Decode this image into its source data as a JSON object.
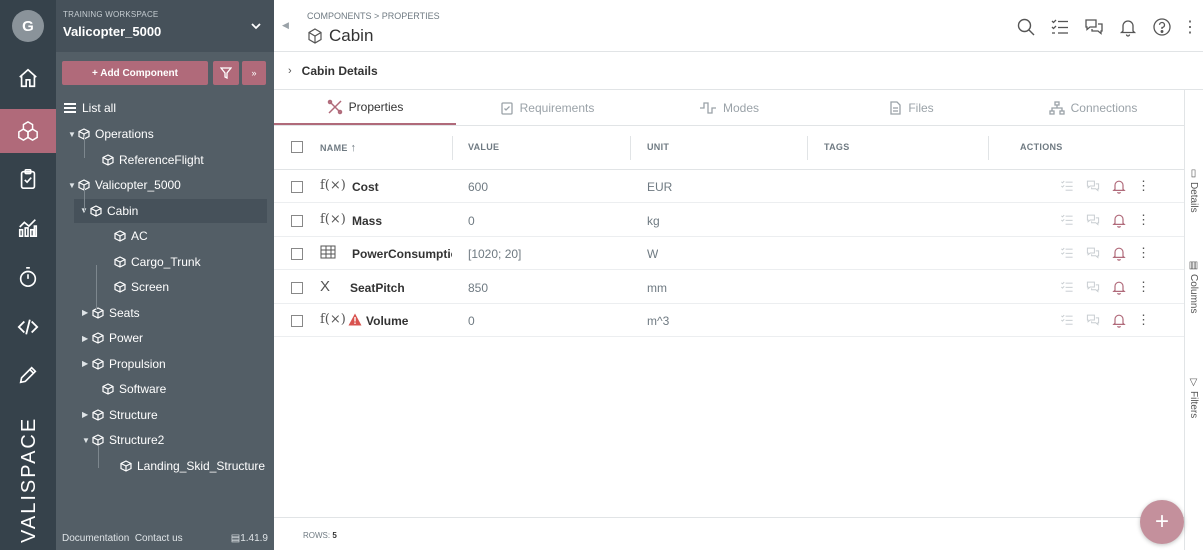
{
  "colors": {
    "accent": "#b06a7a",
    "rail": "#36424b",
    "sidebar": "#535e66",
    "warning": "#d9534f"
  },
  "user": {
    "initial": "G"
  },
  "workspace": {
    "label": "TRAINING WORKSPACE",
    "name": "Valicopter_5000"
  },
  "sidebar": {
    "add_component_label": "+ Add Component",
    "list_all_label": "List all",
    "tree": [
      {
        "label": "Operations",
        "expanded": true
      },
      {
        "label": "ReferenceFlight"
      },
      {
        "label": "Valicopter_5000",
        "expanded": true
      },
      {
        "label": "Cabin",
        "expanded": true,
        "selected": true
      },
      {
        "label": "AC"
      },
      {
        "label": "Cargo_Trunk"
      },
      {
        "label": "Screen"
      },
      {
        "label": "Seats",
        "expanded": false
      },
      {
        "label": "Power",
        "expanded": false
      },
      {
        "label": "Propulsion",
        "expanded": false
      },
      {
        "label": "Software"
      },
      {
        "label": "Structure",
        "expanded": false
      },
      {
        "label": "Structure2",
        "expanded": true
      },
      {
        "label": "Landing_Skid_Structure"
      }
    ],
    "footer": {
      "documentation": "Documentation",
      "contact": "Contact us",
      "version": "1.41.9"
    }
  },
  "brand": {
    "logo_text": "VALISPACE"
  },
  "header": {
    "breadcrumb": "COMPONENTS > PROPERTIES",
    "title": "Cabin"
  },
  "section": {
    "title": "Cabin Details"
  },
  "tabs": [
    {
      "label": "Properties",
      "icon": "properties-icon",
      "active": true
    },
    {
      "label": "Requirements",
      "icon": "requirements-icon"
    },
    {
      "label": "Modes",
      "icon": "modes-icon"
    },
    {
      "label": "Files",
      "icon": "files-icon"
    },
    {
      "label": "Connections",
      "icon": "connections-icon"
    }
  ],
  "table": {
    "columns": {
      "name": "NAME",
      "value": "VALUE",
      "unit": "UNIT",
      "tags": "TAGS",
      "actions": "ACTIONS"
    },
    "rows": [
      {
        "type": "f(×)",
        "name": "Cost",
        "value": "600",
        "unit": "EUR",
        "warning": false
      },
      {
        "type": "f(×)",
        "name": "Mass",
        "value": "0",
        "unit": "kg",
        "warning": false
      },
      {
        "type": "table",
        "name": "PowerConsumption",
        "value": "[1020; 20]",
        "unit": "W",
        "warning": false
      },
      {
        "type": "X",
        "name": "SeatPitch",
        "value": "850",
        "unit": "mm",
        "warning": false
      },
      {
        "type": "f(×)",
        "name": "Volume",
        "value": "0",
        "unit": "m^3",
        "warning": true
      }
    ],
    "footer_label": "ROWS:",
    "row_count": "5"
  },
  "right_rail": {
    "details": "Details",
    "columns": "Columns",
    "filters": "Filters"
  },
  "fab": {
    "label": "+"
  }
}
